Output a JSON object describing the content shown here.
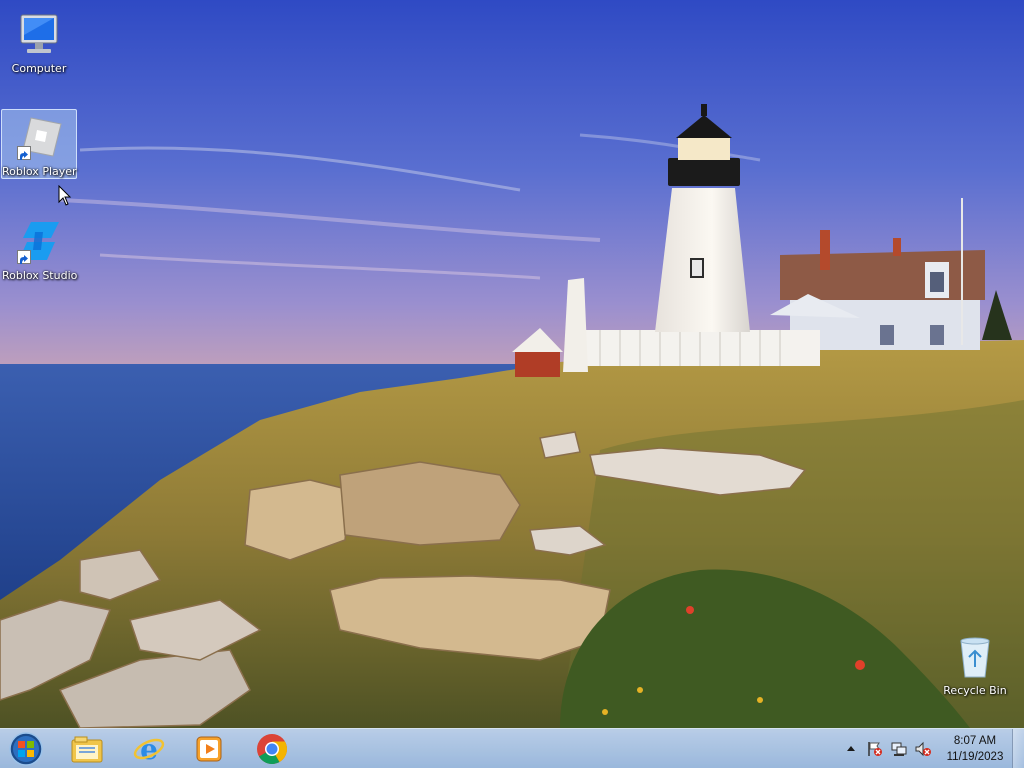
{
  "desktop": {
    "icons": [
      {
        "label": "Computer",
        "icon": "computer-icon"
      },
      {
        "label": "Roblox Player",
        "icon": "roblox-player-icon",
        "shortcut": true,
        "selected": true
      },
      {
        "label": "Roblox Studio",
        "icon": "roblox-studio-icon",
        "shortcut": true
      },
      {
        "label": "Recycle Bin",
        "icon": "recycle-bin-icon"
      }
    ]
  },
  "taskbar": {
    "start_button": "start-orb-icon",
    "pinned": [
      {
        "icon": "windows-explorer-icon"
      },
      {
        "icon": "internet-explorer-icon"
      },
      {
        "icon": "windows-media-player-icon"
      },
      {
        "icon": "google-chrome-icon"
      }
    ],
    "tray": {
      "icons": [
        "show-hidden-icons-icon",
        "action-center-flag-icon",
        "network-icon",
        "volume-muted-icon"
      ],
      "time": "8:07 AM",
      "date": "11/19/2023"
    }
  },
  "colors": {
    "sky_top": "#3450c4",
    "sea": "#2b4f9a",
    "grass": "#a98a3a",
    "taskbar": "#b5cde6"
  }
}
